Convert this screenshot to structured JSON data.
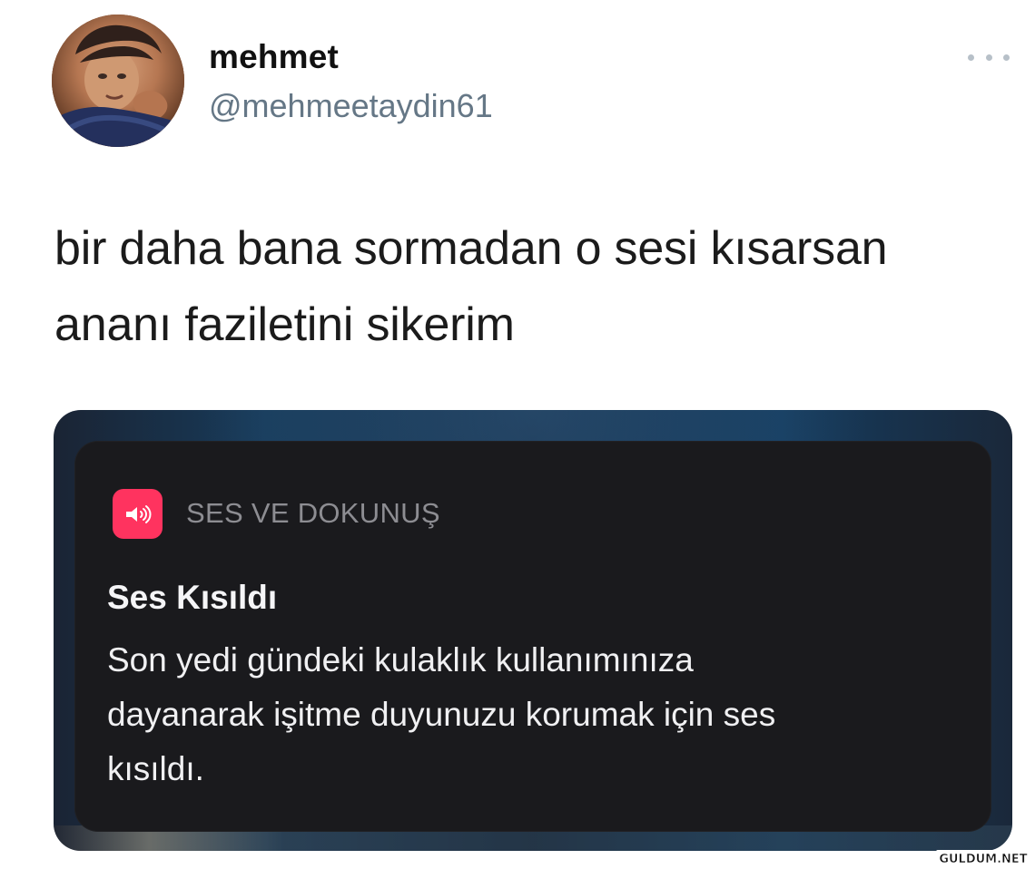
{
  "tweet": {
    "author": {
      "display_name": "mehmet",
      "handle": "@mehmeetaydin61"
    },
    "text": "bir daha bana sormadan o sesi kısarsan\nananı faziletini sikerim",
    "more_icon": "more-horizontal-icon"
  },
  "notification": {
    "app_name": "SES VE DOKUNUŞ",
    "title": "Ses Kısıldı",
    "body": "Son yedi gündeki kulaklık kullanımınıza\ndayanarak işitme duyunuzu korumak için ses\nkısıldı.",
    "icon": "speaker-icon",
    "accent_color": "#ff335f"
  },
  "watermark": {
    "text": "GULDUM.NET"
  }
}
